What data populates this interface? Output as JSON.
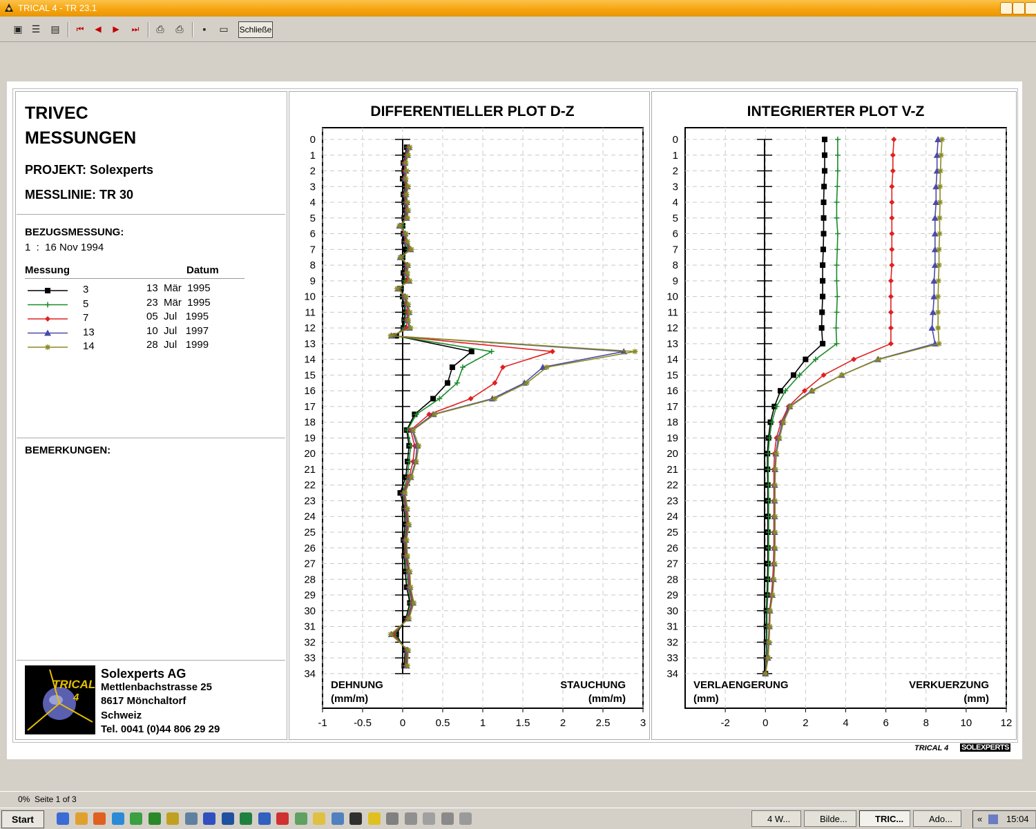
{
  "window": {
    "title": "TRICAL 4 - TR 23.1"
  },
  "toolbar": {
    "close_label": "Schließe",
    "icons": [
      "page-view-icon",
      "list-view-icon",
      "thumbnail-view-icon",
      "first-page-icon",
      "prev-page-icon",
      "next-page-icon",
      "last-page-icon",
      "print-setup-icon",
      "print-icon",
      "save-icon",
      "open-icon"
    ]
  },
  "header": {
    "title_line1": "TRIVEC",
    "title_line2": "MESSUNGEN",
    "project": "PROJEKT: Solexperts",
    "messlinie": "MESSLINIE: TR 30"
  },
  "bezug": {
    "label": "BEZUGSMESSUNG:",
    "value": "1  :  16 Nov 1994"
  },
  "legend": {
    "col_messung": "Messung",
    "col_datum": "Datum",
    "rows": [
      {
        "num": "3",
        "date": "13  Mär  1995",
        "color": "#000000",
        "marker": "square"
      },
      {
        "num": "5",
        "date": "23  Mär  1995",
        "color": "#1a8a2a",
        "marker": "plus"
      },
      {
        "num": "7",
        "date": "05  Jul   1995",
        "color": "#e02020",
        "marker": "diamond"
      },
      {
        "num": "13",
        "date": "10  Jul   1997",
        "color": "#4a4aa8",
        "marker": "triangle"
      },
      {
        "num": "14",
        "date": "28  Jul   1999",
        "color": "#8a8a20",
        "marker": "star"
      }
    ]
  },
  "remarks": {
    "label": "BEMERKUNGEN:"
  },
  "company": {
    "logo_text_1": "TRICAL",
    "logo_text_2": "4",
    "name": "Solexperts AG",
    "street": "Mettlenbachstrasse 25",
    "city": "8617 Mönchaltorf",
    "country": "Schweiz",
    "tel": "Tel. 0041 (0)44 806 29 29"
  },
  "footer": {
    "trical": "TRICAL 4",
    "brand": "SOLEXPERTS"
  },
  "status": {
    "zoom": "0%",
    "page": "Seite 1 of 3"
  },
  "taskbar": {
    "start": "Start",
    "tasks": [
      "4 W...",
      "Bilde...",
      "TRIC...",
      "Ado..."
    ],
    "clock": "15:04",
    "chevron": "«"
  },
  "chart_data": [
    {
      "type": "line",
      "title": "DIFFERENTIELLER PLOT D-Z",
      "left_label": "DEHNUNG",
      "left_unit": "(mm/m)",
      "right_label": "STAUCHUNG",
      "right_unit": "(mm/m)",
      "xlim": [
        -1,
        3
      ],
      "xticks": [
        "-1",
        "-0.5",
        "0",
        "0.5",
        "1",
        "1.5",
        "2",
        "2.5",
        "3"
      ],
      "ylim": [
        0,
        34
      ],
      "y_inverted": true,
      "y": [
        0.5,
        1,
        1.5,
        2,
        2.5,
        3,
        3.5,
        4,
        4.5,
        5,
        5.5,
        6,
        6.5,
        7,
        7.5,
        8,
        8.5,
        9,
        9.5,
        10,
        10.5,
        11,
        11.5,
        12,
        12.5,
        13.5,
        14.5,
        15.5,
        16.5,
        17.5,
        18.5,
        19.5,
        20.5,
        21.5,
        22.5,
        23.5,
        24.5,
        25.5,
        26.5,
        27.5,
        28.5,
        29.5,
        30.5,
        31.5,
        32.5,
        33.5
      ],
      "series": [
        {
          "name": "3",
          "values": [
            0.05,
            0.03,
            0.01,
            0.02,
            0.0,
            0.03,
            0.01,
            0.02,
            0.03,
            0.02,
            0.0,
            0.01,
            0.02,
            0.04,
            0.0,
            0.03,
            0.01,
            0.02,
            -0.02,
            0.0,
            0.02,
            0.03,
            0.02,
            0.01,
            -0.08,
            0.86,
            0.62,
            0.56,
            0.38,
            0.15,
            0.05,
            0.08,
            0.06,
            0.04,
            -0.03,
            0.02,
            0.03,
            0.01,
            0.02,
            0.03,
            0.05,
            0.09,
            0.04,
            -0.08,
            0.03,
            0.02
          ]
        },
        {
          "name": "5",
          "values": [
            0.06,
            0.04,
            0.02,
            0.03,
            0.01,
            0.04,
            0.02,
            0.03,
            0.04,
            0.03,
            0.0,
            0.02,
            0.03,
            0.07,
            0.0,
            0.04,
            0.03,
            0.03,
            -0.03,
            0.0,
            0.03,
            0.04,
            0.03,
            0.02,
            -0.1,
            1.11,
            0.75,
            0.68,
            0.46,
            0.17,
            0.06,
            0.1,
            0.08,
            0.06,
            0.0,
            0.03,
            0.05,
            0.02,
            0.03,
            0.05,
            0.07,
            0.1,
            0.05,
            -0.1,
            0.04,
            0.03
          ]
        },
        {
          "name": "7",
          "values": [
            0.07,
            0.05,
            0.02,
            0.03,
            0.02,
            0.05,
            0.03,
            0.04,
            0.05,
            0.04,
            -0.03,
            0.02,
            0.04,
            0.09,
            -0.02,
            0.05,
            0.04,
            0.06,
            -0.05,
            0.02,
            0.05,
            0.06,
            0.05,
            0.05,
            -0.12,
            1.87,
            1.25,
            1.15,
            0.85,
            0.33,
            0.1,
            0.15,
            0.13,
            0.08,
            0.01,
            0.04,
            0.06,
            0.03,
            0.04,
            0.07,
            0.08,
            0.12,
            0.06,
            -0.12,
            0.05,
            0.04
          ]
        },
        {
          "name": "13",
          "values": [
            0.08,
            0.06,
            0.03,
            0.04,
            0.03,
            0.06,
            0.04,
            0.05,
            0.06,
            0.05,
            -0.04,
            0.03,
            0.05,
            0.1,
            -0.03,
            0.06,
            0.05,
            0.08,
            -0.06,
            0.03,
            0.06,
            0.08,
            0.06,
            0.08,
            -0.14,
            2.76,
            1.75,
            1.52,
            1.12,
            0.38,
            0.12,
            0.18,
            0.16,
            0.1,
            0.02,
            0.05,
            0.07,
            0.04,
            0.05,
            0.08,
            0.09,
            0.13,
            0.07,
            -0.14,
            0.06,
            0.05
          ]
        },
        {
          "name": "14",
          "values": [
            0.09,
            0.07,
            0.04,
            0.05,
            0.04,
            0.07,
            0.05,
            0.06,
            0.07,
            0.06,
            -0.04,
            0.04,
            0.06,
            0.11,
            -0.03,
            0.07,
            0.06,
            0.09,
            -0.07,
            0.04,
            0.07,
            0.09,
            0.07,
            0.1,
            -0.15,
            2.9,
            1.8,
            1.55,
            1.15,
            0.4,
            0.13,
            0.2,
            0.17,
            0.11,
            0.03,
            0.06,
            0.08,
            0.05,
            0.06,
            0.09,
            0.1,
            0.14,
            0.08,
            -0.15,
            0.07,
            0.06
          ]
        }
      ]
    },
    {
      "type": "line",
      "title": "INTEGRIERTER PLOT V-Z",
      "left_label": "VERLAENGERUNG",
      "left_unit": "(mm)",
      "right_label": "VERKUERZUNG",
      "right_unit": "(mm)",
      "xlim": [
        -4,
        12
      ],
      "xticks": [
        "-2",
        "0",
        "2",
        "4",
        "6",
        "8",
        "10",
        "12"
      ],
      "ylim": [
        0,
        34
      ],
      "y_inverted": true,
      "y": [
        0,
        1,
        2,
        3,
        4,
        5,
        6,
        7,
        8,
        9,
        10,
        11,
        12,
        13,
        14,
        15,
        16,
        17,
        18,
        19,
        20,
        21,
        22,
        23,
        24,
        25,
        26,
        27,
        28,
        29,
        30,
        31,
        32,
        33,
        34
      ],
      "series": [
        {
          "name": "3",
          "values": [
            2.95,
            2.95,
            2.95,
            2.92,
            2.9,
            2.9,
            2.9,
            2.88,
            2.85,
            2.85,
            2.85,
            2.82,
            2.8,
            2.85,
            2.0,
            1.4,
            0.75,
            0.45,
            0.25,
            0.15,
            0.1,
            0.1,
            0.12,
            0.12,
            0.12,
            0.12,
            0.12,
            0.12,
            0.1,
            0.08,
            0.05,
            0.05,
            0.05,
            0.05,
            0.0
          ]
        },
        {
          "name": "5",
          "values": [
            3.6,
            3.6,
            3.6,
            3.58,
            3.55,
            3.55,
            3.6,
            3.58,
            3.55,
            3.55,
            3.58,
            3.55,
            3.52,
            3.55,
            2.5,
            1.7,
            1.0,
            0.55,
            0.32,
            0.2,
            0.14,
            0.14,
            0.15,
            0.16,
            0.16,
            0.16,
            0.16,
            0.16,
            0.14,
            0.12,
            0.08,
            0.08,
            0.07,
            0.06,
            0.0
          ]
        },
        {
          "name": "7",
          "values": [
            6.4,
            6.35,
            6.35,
            6.3,
            6.3,
            6.3,
            6.3,
            6.3,
            6.3,
            6.25,
            6.25,
            6.25,
            6.25,
            6.25,
            4.4,
            2.9,
            1.95,
            1.15,
            0.78,
            0.55,
            0.45,
            0.42,
            0.42,
            0.42,
            0.42,
            0.42,
            0.42,
            0.4,
            0.36,
            0.3,
            0.2,
            0.18,
            0.15,
            0.1,
            0.0
          ]
        },
        {
          "name": "13",
          "values": [
            8.6,
            8.55,
            8.55,
            8.5,
            8.5,
            8.45,
            8.45,
            8.45,
            8.45,
            8.4,
            8.4,
            8.35,
            8.3,
            8.45,
            5.6,
            3.8,
            2.3,
            1.2,
            0.85,
            0.65,
            0.52,
            0.48,
            0.46,
            0.46,
            0.46,
            0.46,
            0.46,
            0.44,
            0.4,
            0.34,
            0.22,
            0.2,
            0.16,
            0.12,
            0.0
          ]
        },
        {
          "name": "14",
          "values": [
            8.8,
            8.75,
            8.72,
            8.7,
            8.7,
            8.68,
            8.68,
            8.65,
            8.65,
            8.62,
            8.6,
            8.6,
            8.6,
            8.65,
            5.65,
            3.8,
            2.35,
            1.25,
            0.9,
            0.7,
            0.55,
            0.5,
            0.48,
            0.48,
            0.48,
            0.48,
            0.48,
            0.46,
            0.42,
            0.36,
            0.24,
            0.22,
            0.18,
            0.14,
            0.0
          ]
        }
      ]
    }
  ]
}
